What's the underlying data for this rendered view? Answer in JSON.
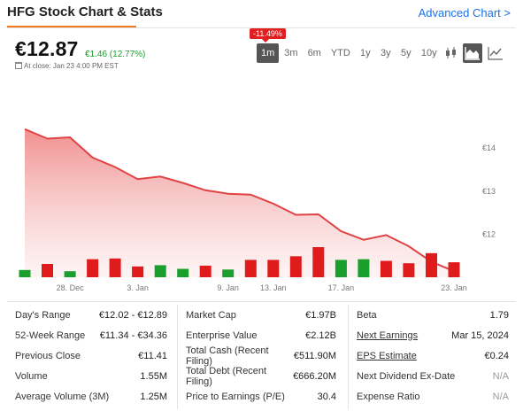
{
  "header": {
    "title": "HFG Stock Chart & Stats",
    "advanced_link": "Advanced Chart >"
  },
  "quote": {
    "price": "€12.87",
    "change": "€1.46 (12.77%)",
    "close_note": "At close: Jan 23 4:00 PM EST",
    "period_change_badge": "-11.49%"
  },
  "ranges": [
    "1m",
    "3m",
    "6m",
    "YTD",
    "1y",
    "3y",
    "5y",
    "10y"
  ],
  "active_range": "1m",
  "chart_types": [
    "candlestick-icon",
    "area-chart-icon",
    "line-chart-icon"
  ],
  "active_chart_type": "area-chart-icon",
  "colors": {
    "up": "#1a9e2c",
    "down": "#e01b1b",
    "area_line": "#e04343",
    "accent": "#f07b23",
    "link": "#1a73e8"
  },
  "chart_data": {
    "type": "area",
    "x": [
      "Dec 26",
      "Dec 27",
      "Dec 28",
      "Dec 29",
      "Jan 2",
      "Jan 3",
      "Jan 4",
      "Jan 5",
      "Jan 8",
      "Jan 9",
      "Jan 10",
      "Jan 11",
      "Jan 12",
      "Jan 15",
      "Jan 16",
      "Jan 17",
      "Jan 18",
      "Jan 19",
      "Jan 22",
      "Jan 23"
    ],
    "price": [
      14.44,
      14.22,
      14.25,
      13.78,
      13.56,
      13.28,
      13.34,
      13.19,
      13.02,
      12.94,
      12.92,
      12.71,
      12.45,
      12.46,
      12.07,
      11.87,
      11.98,
      11.72,
      11.36,
      11.14
    ],
    "volume_direction": [
      "up",
      "down",
      "up",
      "down",
      "down",
      "down",
      "up",
      "up",
      "down",
      "up",
      "down",
      "down",
      "down",
      "down",
      "up",
      "up",
      "down",
      "down",
      "down",
      "down"
    ],
    "volume_relative": [
      0.3,
      0.55,
      0.25,
      0.75,
      0.78,
      0.45,
      0.5,
      0.35,
      0.48,
      0.32,
      0.72,
      0.72,
      0.87,
      1.25,
      0.72,
      0.75,
      0.68,
      0.58,
      1.0,
      0.62
    ],
    "x_ticks": [
      "28. Dec",
      "3. Jan",
      "9. Jan",
      "13. Jan",
      "17. Jan",
      "23. Jan"
    ],
    "y_ticks": [
      "€14",
      "€13",
      "€12"
    ],
    "ylim": [
      11.0,
      14.6
    ],
    "grid": false,
    "legend": "none"
  },
  "stats": {
    "col1": [
      {
        "label": "Day's Range",
        "value": "€12.02 - €12.89"
      },
      {
        "label": "52-Week Range",
        "value": "€11.34 - €34.36"
      },
      {
        "label": "Previous Close",
        "value": "€11.41"
      },
      {
        "label": "Volume",
        "value": "1.55M"
      },
      {
        "label": "Average Volume (3M)",
        "value": "1.25M"
      }
    ],
    "col2": [
      {
        "label": "Market Cap",
        "value": "€1.97B"
      },
      {
        "label": "Enterprise Value",
        "value": "€2.12B"
      },
      {
        "label": "Total Cash (Recent Filing)",
        "value": "€511.90M"
      },
      {
        "label": "Total Debt (Recent Filing)",
        "value": "€666.20M"
      },
      {
        "label": "Price to Earnings (P/E)",
        "value": "30.4"
      }
    ],
    "col3": [
      {
        "label": "Beta",
        "value": "1.79"
      },
      {
        "label": "Next Earnings",
        "value": "Mar 15, 2024"
      },
      {
        "label": "EPS Estimate",
        "value": "€0.24"
      },
      {
        "label": "Next Dividend Ex-Date",
        "value": "N/A"
      },
      {
        "label": "Expense Ratio",
        "value": "N/A"
      }
    ]
  }
}
